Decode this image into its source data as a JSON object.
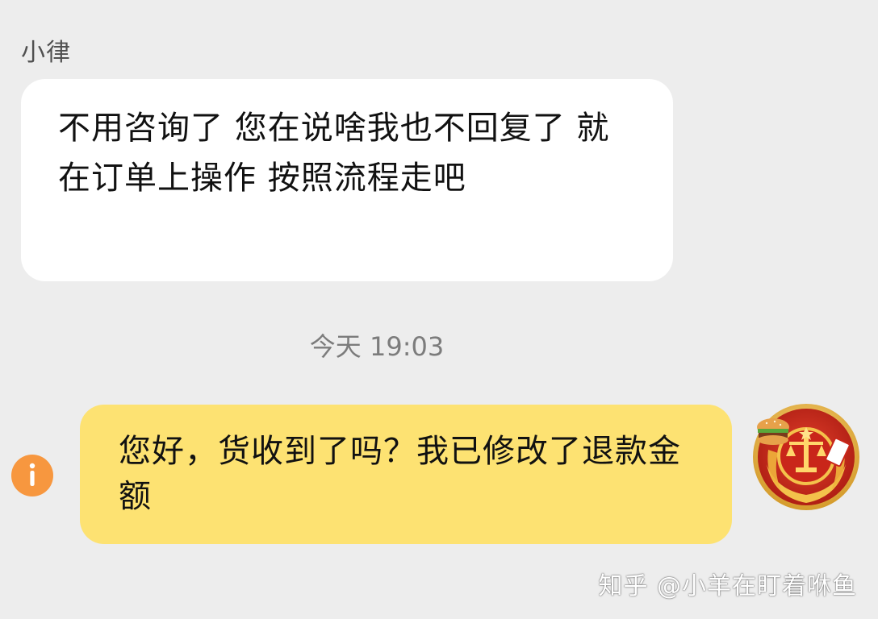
{
  "chat": {
    "sender_name": "小律",
    "incoming_message": "不用咨询了 您在说啥我也不回复了 就在订单上操作 按照流程走吧",
    "timestamp": "今天 19:03",
    "outgoing_message": "您好，货收到了吗？我已修改了退款金额",
    "info_icon": "info-icon",
    "avatar_icon": "court-emblem-avatar"
  },
  "watermark": {
    "text": "知乎 @小羊在盯着咻鱼"
  },
  "colors": {
    "background": "#ededed",
    "incoming_bubble": "#ffffff",
    "outgoing_bubble": "#fde272",
    "info_icon": "#f7973f",
    "timestamp_text": "#7c7c7c"
  }
}
